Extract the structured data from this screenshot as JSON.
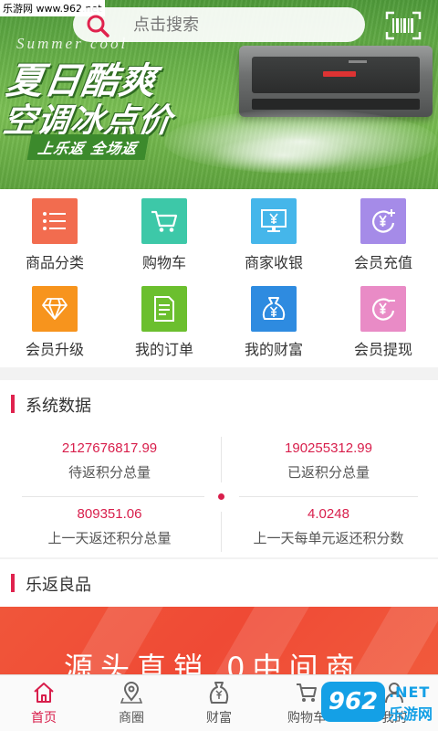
{
  "watermark_top": "乐游网 www.962.net",
  "search": {
    "placeholder": "点击搜索"
  },
  "banner": {
    "script_text": "Summer cool",
    "headline1": "夏日酷爽",
    "headline2": "空调冰点价",
    "tagline": "上乐返  全场返"
  },
  "menu": [
    {
      "label": "商品分类",
      "icon": "list-icon",
      "color": "#f26c4f"
    },
    {
      "label": "购物车",
      "icon": "cart-icon",
      "color": "#3dc8a8"
    },
    {
      "label": "商家收银",
      "icon": "monitor-yen-icon",
      "color": "#45b6ea"
    },
    {
      "label": "会员充值",
      "icon": "recharge-icon",
      "color": "#a58be8"
    },
    {
      "label": "会员升级",
      "icon": "diamond-icon",
      "color": "#f7941d"
    },
    {
      "label": "我的订单",
      "icon": "order-icon",
      "color": "#6bbf2e"
    },
    {
      "label": "我的财富",
      "icon": "money-bag-icon",
      "color": "#2e8be0"
    },
    {
      "label": "会员提现",
      "icon": "withdraw-icon",
      "color": "#e98bc6"
    }
  ],
  "system": {
    "title": "系统数据",
    "stats": [
      {
        "value": "2127676817.99",
        "label": "待返积分总量"
      },
      {
        "value": "190255312.99",
        "label": "已返积分总量"
      },
      {
        "value": "809351.06",
        "label": "上一天返还积分总量"
      },
      {
        "value": "4.0248",
        "label": "上一天每单元返还积分数"
      }
    ]
  },
  "lefan": {
    "title": "乐返良品",
    "promo_text": "源头直销  0中间商"
  },
  "tabs": [
    {
      "label": "首页",
      "icon": "home-icon",
      "active": true
    },
    {
      "label": "商圈",
      "icon": "location-icon",
      "active": false
    },
    {
      "label": "财富",
      "icon": "wealth-bag-icon",
      "active": false
    },
    {
      "label": "购物车",
      "icon": "cart-icon",
      "active": false
    },
    {
      "label": "我的",
      "icon": "user-icon",
      "active": false
    }
  ],
  "watermark_bottom": {
    "logo": "962",
    "net": ".NET",
    "cn": "乐游网"
  },
  "colors": {
    "accent": "#d81e4b"
  }
}
